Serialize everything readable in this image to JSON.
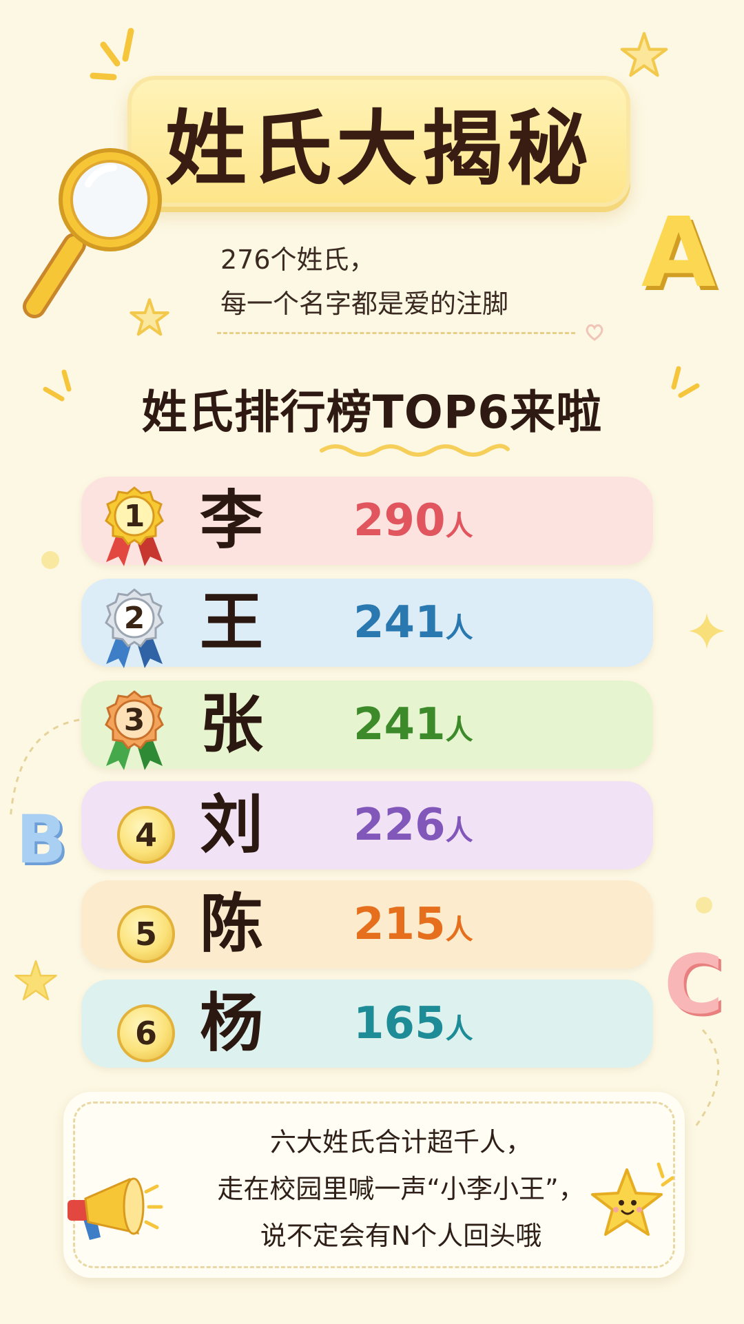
{
  "title": "姓氏大揭秘",
  "subtitle": {
    "line1": "276个姓氏，",
    "line2": "每一个名字都是爱的注脚"
  },
  "heading": "姓氏排行榜TOP6来啦",
  "ranking": [
    {
      "rank": "1",
      "surname": "李",
      "count": "290",
      "unit": "人",
      "count_color": "#e0555e",
      "row_color": "#fde3df",
      "medal": "gold"
    },
    {
      "rank": "2",
      "surname": "王",
      "count": "241",
      "unit": "人",
      "count_color": "#2a78b0",
      "row_color": "#dcedf8",
      "medal": "silver"
    },
    {
      "rank": "3",
      "surname": "张",
      "count": "241",
      "unit": "人",
      "count_color": "#3d8a2a",
      "row_color": "#e6f4cf",
      "medal": "bronze"
    },
    {
      "rank": "4",
      "surname": "刘",
      "count": "226",
      "unit": "人",
      "count_color": "#8157ba",
      "row_color": "#f1e2f6",
      "medal": "coin"
    },
    {
      "rank": "5",
      "surname": "陈",
      "count": "215",
      "unit": "人",
      "count_color": "#e56f1c",
      "row_color": "#fcebcc",
      "medal": "coin"
    },
    {
      "rank": "6",
      "surname": "杨",
      "count": "165",
      "unit": "人",
      "count_color": "#1e8c96",
      "row_color": "#ddf2ef",
      "medal": "coin"
    }
  ],
  "note": {
    "line1": "六大姓氏合计超千人，",
    "line2": "走在校园里喊一声“小李小王”，",
    "line3": "说不定会有N个人回头哦"
  },
  "decorations": {
    "letters": [
      "A",
      "B",
      "C"
    ],
    "icons": [
      "magnifier-icon",
      "megaphone-icon",
      "smiling-star-icon",
      "star-icon",
      "heart-icon"
    ]
  }
}
